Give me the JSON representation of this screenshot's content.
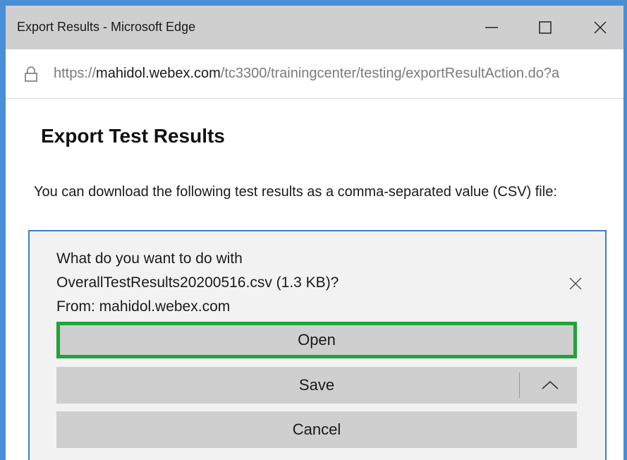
{
  "window": {
    "title": "Export Results - Microsoft Edge",
    "accent_color": "#4a8ed6"
  },
  "window_controls": {
    "minimize_icon": "minimize-icon",
    "maximize_icon": "maximize-icon",
    "close_icon": "close-icon"
  },
  "address": {
    "lock_icon": "lock-icon",
    "scheme": "https://",
    "host": "mahidol.webex.com",
    "path": "/tc3300/trainingcenter/testing/exportResultAction.do?a"
  },
  "page": {
    "heading": "Export Test Results",
    "description": "You can download the following test results as a comma-separated value (CSV) file:"
  },
  "download": {
    "question_line1": "What do you want to do with",
    "question_line2": "OverallTestResults20200516.csv (1.3 KB)?",
    "question_line3": "From: mahidol.webex.com",
    "dismiss_icon": "close-icon",
    "open_label": "Open",
    "save_label": "Save",
    "save_options_icon": "chevron-up-icon",
    "cancel_label": "Cancel",
    "highlight_color": "#1fa33a",
    "panel_border_color": "#3b7fc4"
  }
}
